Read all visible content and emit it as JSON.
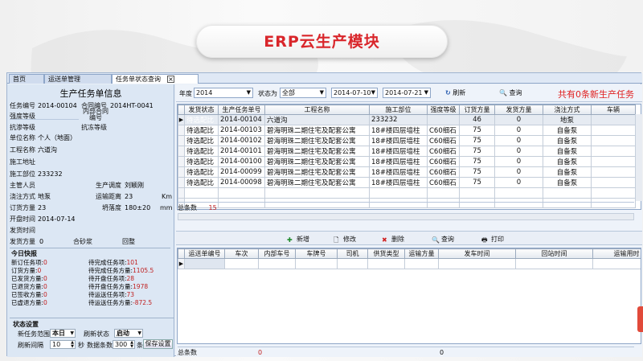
{
  "slide": {
    "title": "ERP云生产模块"
  },
  "tabs": [
    {
      "label": "首页"
    },
    {
      "label": "运送单管理"
    },
    {
      "label": "任务单状态查询"
    }
  ],
  "left": {
    "title": "生产任务单信息",
    "fields": {
      "task_no_label": "任务编号",
      "task_no": "2014-00104",
      "contract_no_label": "合同编号",
      "contract_no": "2014HT-0041",
      "internal_no_label": "内部合同编号",
      "strength_label": "强度等级",
      "anti_seep_label": "抗渗等级",
      "anti_freeze_label": "抗冻等级",
      "unit_name_label": "单位名称",
      "unit_name": "个人（地面）",
      "project_label": "工程名称",
      "project": "六道沟",
      "address_label": "施工地址",
      "site_label": "施工部位",
      "site": "233232",
      "manager_label": "主管人员",
      "dispatcher_label": "生产调度",
      "dispatcher": "刘颖刚",
      "pour_label": "浇注方式",
      "pour": "地泵",
      "distance_label": "运输距离",
      "distance": "23",
      "distance_unit": "Km",
      "order_qty_label": "订货方量",
      "order_qty": "23",
      "slump_label": "坍落度",
      "slump": "180±20",
      "slump_unit": "mm",
      "start_label": "开盘时间",
      "start": "2014-07-14",
      "delivery_time_label": "发货时间",
      "sent_qty_label": "发货方量",
      "sent_qty": "0",
      "remain_label": "合砂浆",
      "return_label": "回整"
    },
    "daily": {
      "title": "今日快报",
      "items": [
        {
          "k": "新订任务项:",
          "v": "0",
          "k2": "待完成任务项:",
          "v2": "101"
        },
        {
          "k": "订货方量:",
          "v": "0",
          "k2": "待完成任务方量:",
          "v2": "1105.5"
        },
        {
          "k": "已发货方量:",
          "v": "0",
          "k2": "待开盘任务项:",
          "v2": "28"
        },
        {
          "k": "已退货方量:",
          "v": "0",
          "k2": "待开盘任务方量:",
          "v2": "1978"
        },
        {
          "k": "已签收方量:",
          "v": "0",
          "k2": "待运送任务项:",
          "v2": "73"
        },
        {
          "k": "已虚退方量:",
          "v": "0",
          "k2": "待运送任务方量:",
          "v2": "-872.5"
        }
      ]
    },
    "settings": {
      "title": "状态设置",
      "range_label": "新任务范围",
      "range_value": "本日",
      "refresh_state_label": "刷新状态",
      "refresh_state_value": "启动",
      "interval_label": "刷新间隔",
      "interval_value": "10",
      "interval_unit": "秒",
      "count_label": "数据条数",
      "count_value": "300",
      "count_unit": "条",
      "save_label": "保存设置"
    }
  },
  "filter": {
    "year_label": "年度",
    "year": "2014",
    "status_label": "状态为",
    "status": "全部",
    "date_from": "2014-07-10",
    "date_to": "2014-07-21",
    "refresh_label": "刷新",
    "query_label": "查询",
    "notice": "共有0条新生产任务"
  },
  "task_table": {
    "headers": [
      "发货状态",
      "生产任务单号",
      "工程名称",
      "施工部位",
      "强度等级",
      "订货方量",
      "发货方量",
      "浇注方式",
      "车辆"
    ],
    "rows": [
      [
        "待选配比",
        "2014-00104",
        "六道沟",
        "233232",
        "",
        "46",
        "0",
        "地泵"
      ],
      [
        "待选配比",
        "2014-00103",
        "碧海明珠二期住宅及配套公寓",
        "18#楼四层墙柱",
        "C60细石",
        "75",
        "0",
        "自备泵"
      ],
      [
        "待选配比",
        "2014-00102",
        "碧海明珠二期住宅及配套公寓",
        "18#楼四层墙柱",
        "C60细石",
        "75",
        "0",
        "自备泵"
      ],
      [
        "待选配比",
        "2014-00101",
        "碧海明珠二期住宅及配套公寓",
        "18#楼四层墙柱",
        "C60细石",
        "75",
        "0",
        "自备泵"
      ],
      [
        "待选配比",
        "2014-00100",
        "碧海明珠二期住宅及配套公寓",
        "18#楼四层墙柱",
        "C60细石",
        "75",
        "0",
        "自备泵"
      ],
      [
        "待选配比",
        "2014-00099",
        "碧海明珠二期住宅及配套公寓",
        "18#楼四层墙柱",
        "C60细石",
        "75",
        "0",
        "自备泵"
      ],
      [
        "待选配比",
        "2014-00098",
        "碧海明珠二期住宅及配套公寓",
        "18#楼四层墙柱",
        "C60细石",
        "75",
        "0",
        "自备泵"
      ]
    ],
    "total_label": "总条数",
    "total": "15"
  },
  "actions": {
    "add": "新增",
    "edit": "修改",
    "delete": "删除",
    "query": "查询",
    "print": "打印"
  },
  "ship_table": {
    "headers": [
      "运送单编号",
      "车次",
      "内部车号",
      "车牌号",
      "司机",
      "供货类型",
      "运输方量",
      "发车时间",
      "回站时间",
      "运输用时"
    ],
    "total_label": "总条数",
    "total": "0",
    "qty_total": "0"
  },
  "colors": {
    "title_red": "#d9262b",
    "notice_red": "#e02020",
    "daily_value": "#c02020"
  }
}
